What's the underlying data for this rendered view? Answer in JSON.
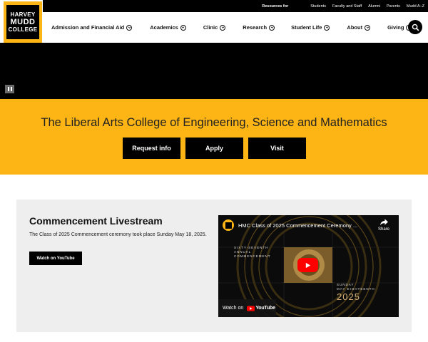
{
  "logo": {
    "lines": [
      "HARVEY",
      "MUDD",
      "COLLEGE"
    ]
  },
  "utility": {
    "label": "Resources for",
    "links": [
      "Students",
      "Faculty and Staff",
      "Alumni",
      "Parents",
      "Mudd A–Z"
    ]
  },
  "nav": {
    "items": [
      "Admission and Financial Aid",
      "Academics",
      "Clinic",
      "Research",
      "Student Life",
      "About",
      "Giving"
    ],
    "search_icon": "search-icon"
  },
  "hero": {
    "pause_icon": "pause-icon"
  },
  "band": {
    "tagline": "The Liberal Arts College of Engineering, Science and Mathematics",
    "buttons": [
      "Request info",
      "Apply",
      "Visit"
    ]
  },
  "commencement": {
    "title": "Commencement Livestream",
    "description": "The Class of 2025 Commencement ceremony took place Sunday May 18, 2025.",
    "button": "Watch on YouTube",
    "video": {
      "title": "HMC Class of 2025 Commencement Ceremony ...",
      "share_label": "Share",
      "side_text": [
        "SIXTY-SEVENTH",
        "ANNUAL",
        "COMMENCEMENT"
      ],
      "date_text": [
        "SUNDAY",
        "MAY EIGHTEENTH"
      ],
      "year": "2025",
      "watch_label": "Watch on",
      "youtube_word": "YouTube"
    }
  },
  "colors": {
    "brand_yellow": "#fdb515",
    "black": "#000000",
    "card_gray": "#eeeeee",
    "youtube_red": "#ff0000"
  }
}
